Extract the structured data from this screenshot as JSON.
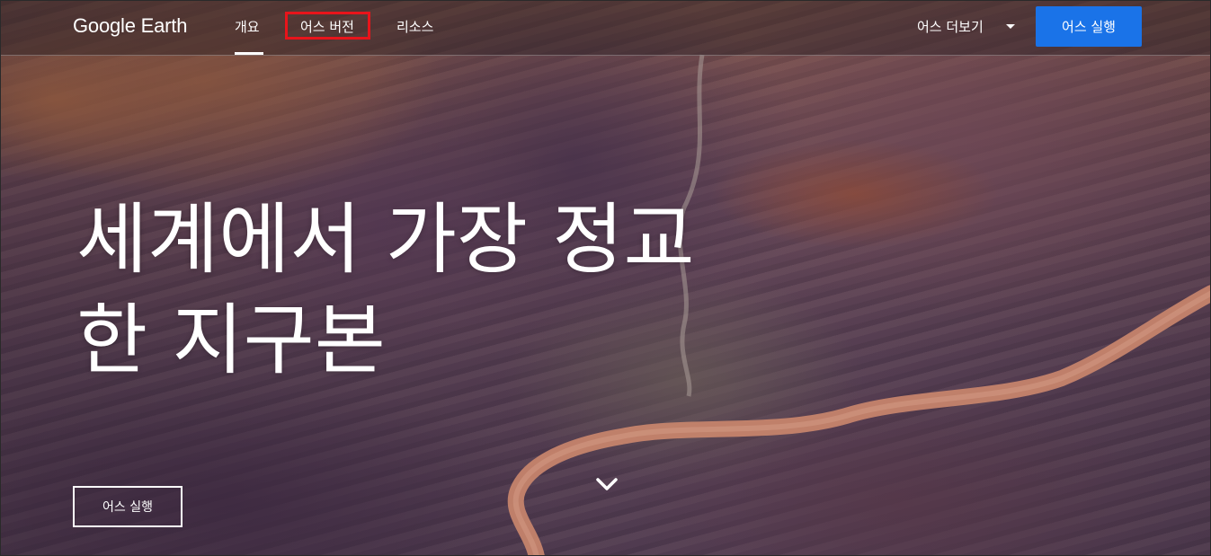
{
  "header": {
    "logo": "Google Earth",
    "nav": [
      {
        "label": "개요"
      },
      {
        "label": "어스 버전"
      },
      {
        "label": "리소스"
      }
    ],
    "more_label": "어스 더보기",
    "launch_label": "어스 실행"
  },
  "hero": {
    "headline_line1": "세계에서 가장 정교",
    "headline_line2": "한 지구본",
    "cta_label": "어스 실행"
  },
  "colors": {
    "accent": "#1a73e8",
    "highlight_box": "#e8141b"
  },
  "icons": {
    "more_caret": "caret-down-icon",
    "scroll": "chevron-down-icon"
  }
}
